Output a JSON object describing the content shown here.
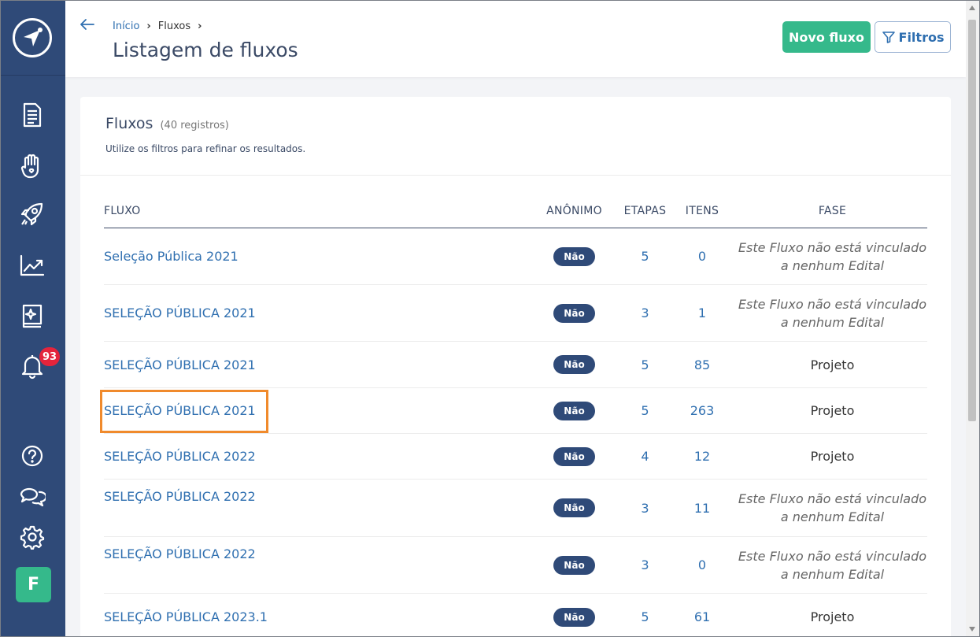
{
  "sidebar": {
    "items": [
      {
        "icon": "document-icon"
      },
      {
        "icon": "hand-heart-icon"
      },
      {
        "icon": "rocket-icon"
      },
      {
        "icon": "trending-chart-icon"
      },
      {
        "icon": "book-sparkle-icon"
      },
      {
        "icon": "bell-icon"
      }
    ],
    "notification_count": "93",
    "bottom_icons": [
      "help-icon",
      "chat-icon",
      "settings-icon"
    ],
    "avatar_letter": "F",
    "colors": {
      "background": "#2f4a78",
      "avatar": "#35b98b",
      "badge": "#e4243c"
    }
  },
  "header": {
    "breadcrumb": [
      "Início",
      "Fluxos"
    ],
    "title": "Listagem de fluxos",
    "new_button": "Novo fluxo",
    "filter_button": "Filtros"
  },
  "card": {
    "title": "Fluxos",
    "count": "(40 registros)",
    "subtitle": "Utilize os filtros para refinar os resultados."
  },
  "table": {
    "columns": [
      "FLUXO",
      "ANÔNIMO",
      "ETAPAS",
      "ITENS",
      "FASE"
    ],
    "rows": [
      {
        "fluxo": "Seleção Pública 2021",
        "anonimo": "Não",
        "etapas": "5",
        "itens": "0",
        "fase1": "Este Fluxo não está vinculado",
        "fase2": "a nenhum Edital"
      },
      {
        "fluxo": "SELEÇÃO PÚBLICA 2021",
        "anonimo": "Não",
        "etapas": "3",
        "itens": "1",
        "fase1": "Este Fluxo não está vinculado",
        "fase2": "a nenhum Edital"
      },
      {
        "fluxo": "SELEÇÃO PÚBLICA 2021",
        "anonimo": "Não",
        "etapas": "5",
        "itens": "85",
        "fase": "Projeto"
      },
      {
        "fluxo": "SELEÇÃO PÚBLICA 2021",
        "anonimo": "Não",
        "etapas": "5",
        "itens": "263",
        "fase": "Projeto"
      },
      {
        "fluxo": "SELEÇÃO PÚBLICA 2022",
        "anonimo": "Não",
        "etapas": "4",
        "itens": "12",
        "fase": "Projeto"
      },
      {
        "fluxo": "SELEÇÃO PÚBLICA 2022",
        "anonimo": "Não",
        "etapas": "3",
        "itens": "11",
        "fase1": "Este Fluxo não está vinculado",
        "fase2": "a nenhum Edital"
      },
      {
        "fluxo": "SELEÇÃO PÚBLICA 2022",
        "anonimo": "Não",
        "etapas": "3",
        "itens": "0",
        "fase1": "Este Fluxo não está vinculado",
        "fase2": "a nenhum Edital"
      },
      {
        "fluxo": "SELEÇÃO PÚBLICA 2023.1",
        "anonimo": "Não",
        "etapas": "5",
        "itens": "61",
        "fase": "Projeto"
      }
    ]
  }
}
